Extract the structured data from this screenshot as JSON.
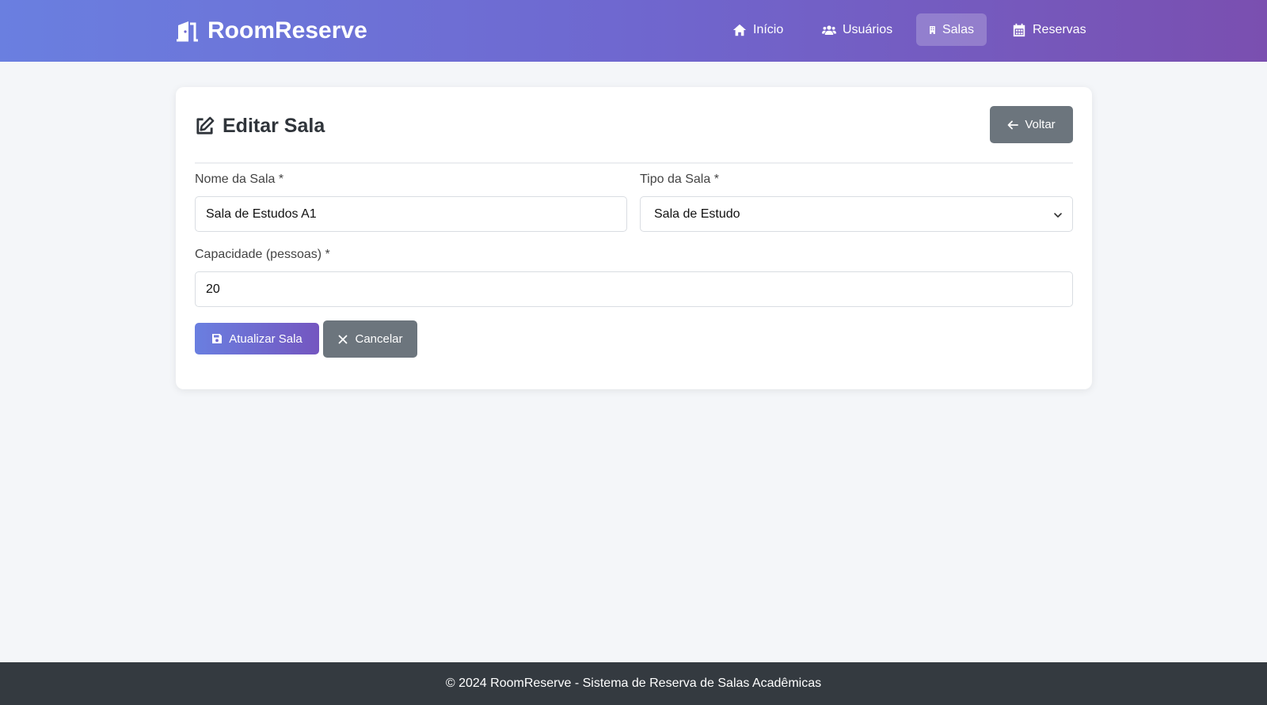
{
  "app": {
    "brand": "RoomReserve"
  },
  "nav": {
    "items": [
      {
        "label": "Início",
        "icon": "home-icon"
      },
      {
        "label": "Usuários",
        "icon": "users-icon"
      },
      {
        "label": "Salas",
        "icon": "building-icon",
        "active": true
      },
      {
        "label": "Reservas",
        "icon": "calendar-icon"
      }
    ]
  },
  "page": {
    "title": "Editar Sala",
    "back_label": "Voltar"
  },
  "form": {
    "nome": {
      "label": "Nome da Sala *",
      "value": "Sala de Estudos A1"
    },
    "tipo": {
      "label": "Tipo da Sala *",
      "value": "Sala de Estudo"
    },
    "capacidade": {
      "label": "Capacidade (pessoas) *",
      "value": "20"
    },
    "submit_label": "Atualizar Sala",
    "cancel_label": "Cancelar"
  },
  "footer": {
    "text": "© 2024 RoomReserve - Sistema de Reserva de Salas Acadêmicas"
  },
  "colors": {
    "navbar_gradient_start": "#6a7fe0",
    "navbar_gradient_end": "#7a4fb0",
    "secondary_button": "#6c757d",
    "footer_bg": "#343a40"
  }
}
